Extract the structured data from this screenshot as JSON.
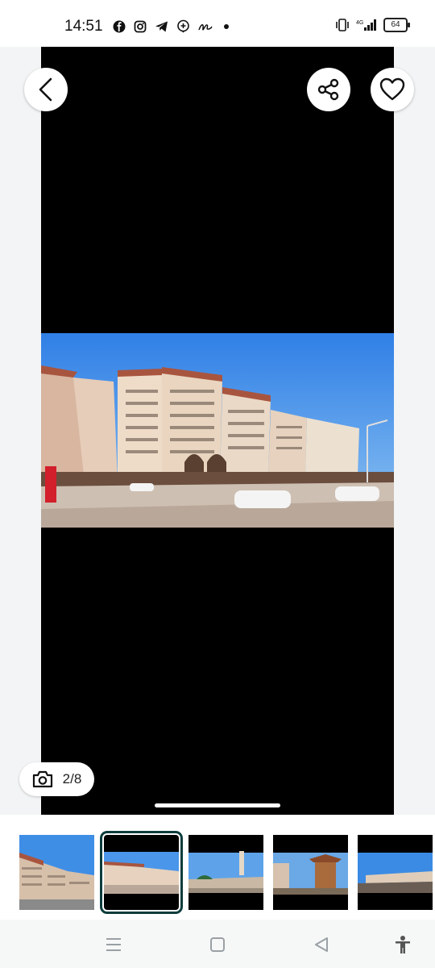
{
  "status_bar": {
    "time": "14:51",
    "icons": [
      "facebook-icon",
      "instagram-icon",
      "telegram-icon",
      "add-location-icon",
      "signature-icon",
      "dot-icon"
    ],
    "right_icons": [
      "vibrate-icon",
      "4g-signal-icon"
    ],
    "battery": "64"
  },
  "gallery": {
    "counter": "2/8",
    "current_index": 2,
    "total": 8,
    "buttons": [
      "back",
      "share",
      "favorite"
    ]
  },
  "thumbnails": [
    {
      "name": "thumb-1",
      "selected": false
    },
    {
      "name": "thumb-2",
      "selected": true
    },
    {
      "name": "thumb-3",
      "selected": false
    },
    {
      "name": "thumb-4",
      "selected": false
    },
    {
      "name": "thumb-5",
      "selected": false
    }
  ],
  "colors": {
    "accent": "#0d3c3c",
    "viewer_bg": "#000000"
  }
}
